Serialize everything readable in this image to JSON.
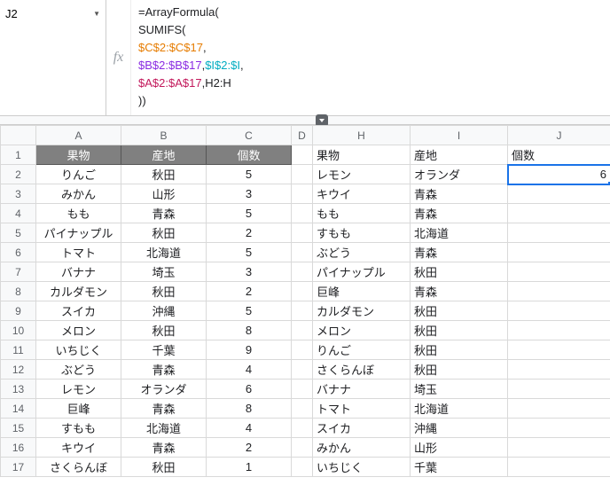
{
  "nameBox": "J2",
  "fx_label": "fx",
  "formula": {
    "line1_plain": "=ArrayFormula(",
    "line2_plain": "SUMIFS(",
    "line3_a": "$C$2:$C$17",
    "comma": ",",
    "line4_a": "$B$2:$B$17",
    "line4_b": "$I$2:$I",
    "line5_a": "$A$2:$A$17",
    "line5_b": "H2:H",
    "line6_plain": "))"
  },
  "columnLetters": [
    "A",
    "B",
    "C",
    "D",
    "H",
    "I",
    "J"
  ],
  "headers_left": {
    "fruit": "果物",
    "origin": "産地",
    "count": "個数"
  },
  "headers_right": {
    "fruit": "果物",
    "origin": "産地",
    "count": "個数"
  },
  "left_rows": [
    {
      "a": "りんご",
      "b": "秋田",
      "c": "5"
    },
    {
      "a": "みかん",
      "b": "山形",
      "c": "3"
    },
    {
      "a": "もも",
      "b": "青森",
      "c": "5"
    },
    {
      "a": "パイナップル",
      "b": "秋田",
      "c": "2"
    },
    {
      "a": "トマト",
      "b": "北海道",
      "c": "5"
    },
    {
      "a": "バナナ",
      "b": "埼玉",
      "c": "3"
    },
    {
      "a": "カルダモン",
      "b": "秋田",
      "c": "2"
    },
    {
      "a": "スイカ",
      "b": "沖縄",
      "c": "5"
    },
    {
      "a": "メロン",
      "b": "秋田",
      "c": "8"
    },
    {
      "a": "いちじく",
      "b": "千葉",
      "c": "9"
    },
    {
      "a": "ぶどう",
      "b": "青森",
      "c": "4"
    },
    {
      "a": "レモン",
      "b": "オランダ",
      "c": "6"
    },
    {
      "a": "巨峰",
      "b": "青森",
      "c": "8"
    },
    {
      "a": "すもも",
      "b": "北海道",
      "c": "4"
    },
    {
      "a": "キウイ",
      "b": "青森",
      "c": "2"
    },
    {
      "a": "さくらんぼ",
      "b": "秋田",
      "c": "1"
    }
  ],
  "right_rows": [
    {
      "h": "レモン",
      "i": "オランダ",
      "j": "6"
    },
    {
      "h": "キウイ",
      "i": "青森",
      "j": ""
    },
    {
      "h": "もも",
      "i": "青森",
      "j": ""
    },
    {
      "h": "すもも",
      "i": "北海道",
      "j": ""
    },
    {
      "h": "ぶどう",
      "i": "青森",
      "j": ""
    },
    {
      "h": "パイナップル",
      "i": "秋田",
      "j": ""
    },
    {
      "h": "巨峰",
      "i": "青森",
      "j": ""
    },
    {
      "h": "カルダモン",
      "i": "秋田",
      "j": ""
    },
    {
      "h": "メロン",
      "i": "秋田",
      "j": ""
    },
    {
      "h": "りんご",
      "i": "秋田",
      "j": ""
    },
    {
      "h": "さくらんぼ",
      "i": "秋田",
      "j": ""
    },
    {
      "h": "バナナ",
      "i": "埼玉",
      "j": ""
    },
    {
      "h": "トマト",
      "i": "北海道",
      "j": ""
    },
    {
      "h": "スイカ",
      "i": "沖縄",
      "j": ""
    },
    {
      "h": "みかん",
      "i": "山形",
      "j": ""
    },
    {
      "h": "いちじく",
      "i": "千葉",
      "j": ""
    }
  ]
}
